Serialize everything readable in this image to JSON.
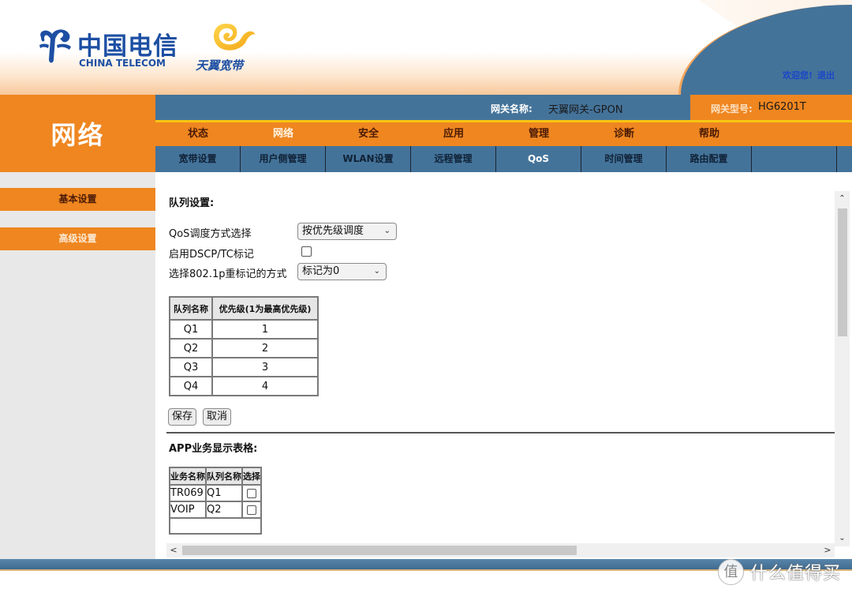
{
  "header": {
    "brand_cn": "中国电信",
    "brand_en": "CHINA TELECOM",
    "sub_brand": "天翼宽带",
    "welcome": "欢迎您!",
    "logout": "退出"
  },
  "section_title": "网络",
  "infobar": {
    "gateway_name_label": "网关名称:",
    "gateway_name": "天翼网关-GPON",
    "gateway_model_label": "网关型号:",
    "gateway_model": "HG6201T"
  },
  "main_nav": [
    {
      "label": "状态",
      "active": false
    },
    {
      "label": "网络",
      "active": true
    },
    {
      "label": "安全",
      "active": false
    },
    {
      "label": "应用",
      "active": false
    },
    {
      "label": "管理",
      "active": false
    },
    {
      "label": "诊断",
      "active": false
    },
    {
      "label": "帮助",
      "active": false
    }
  ],
  "sub_nav": [
    {
      "label": "宽带设置",
      "active": false
    },
    {
      "label": "用户侧管理",
      "active": false
    },
    {
      "label": "WLAN设置",
      "active": false
    },
    {
      "label": "远程管理",
      "active": false
    },
    {
      "label": "QoS",
      "active": true
    },
    {
      "label": "时间管理",
      "active": false
    },
    {
      "label": "路由配置",
      "active": false
    }
  ],
  "sidebar": {
    "items": [
      {
        "label": "基本设置",
        "active": false
      },
      {
        "label": "高级设置",
        "active": true
      }
    ]
  },
  "content": {
    "queue_section_title": "队列设置:",
    "qos_mode_label": "QoS调度方式选择",
    "qos_mode_value": "按优先级调度",
    "dscp_label": "启用DSCP/TC标记",
    "dscp_checked": false,
    "remark_label": "选择802.1p重标记的方式",
    "remark_value": "标记为0",
    "queue_table": {
      "headers": [
        "队列名称",
        "优先级(1为最高优先级)"
      ],
      "rows": [
        [
          "Q1",
          "1"
        ],
        [
          "Q2",
          "2"
        ],
        [
          "Q3",
          "3"
        ],
        [
          "Q4",
          "4"
        ]
      ]
    },
    "save_label": "保存",
    "cancel_label": "取消",
    "app_section_title": "APP业务显示表格:",
    "app_table": {
      "headers": [
        "业务名称",
        "队列名称",
        "选择"
      ],
      "rows": [
        [
          "TR069",
          "Q1",
          false
        ],
        [
          "VOIP",
          "Q2",
          false
        ]
      ]
    }
  },
  "watermark": {
    "icon_char": "值",
    "text": "什么值得买"
  },
  "scroll": {
    "up": "^",
    "down": "v",
    "left": "<",
    "right": ">"
  }
}
